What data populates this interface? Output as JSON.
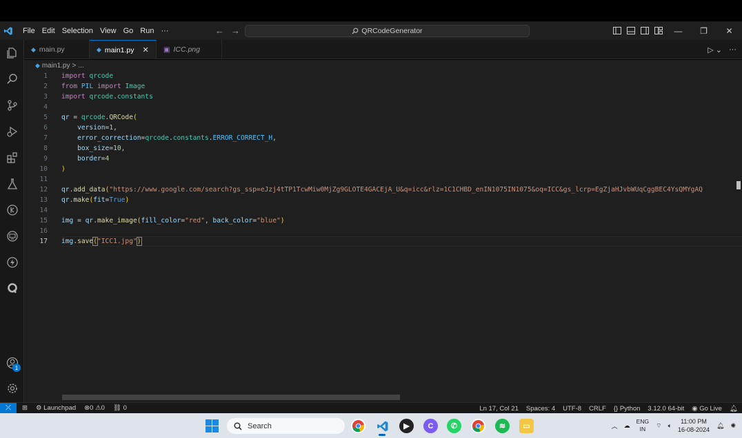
{
  "menu": [
    "File",
    "Edit",
    "Selection",
    "View",
    "Go",
    "Run",
    "···"
  ],
  "search": {
    "label": "QRCodeGenerator"
  },
  "tabs": [
    {
      "label": "main.py"
    },
    {
      "label": "main1.py"
    },
    {
      "label": "ICC.png"
    }
  ],
  "breadcrumb": {
    "file": "main1.py",
    "sep": ">",
    "rest": "..."
  },
  "editor": {
    "line_numbers": [
      "1",
      "2",
      "3",
      "4",
      "5",
      "6",
      "7",
      "8",
      "9",
      "10",
      "11",
      "12",
      "13",
      "14",
      "15",
      "16",
      "17"
    ],
    "current_line": 17,
    "lines": [
      "import qrcode",
      "from PIL import Image",
      "import qrcode.constants",
      "",
      "qr = qrcode.QRCode(",
      "    version=1,",
      "    error_correction=qrcode.constants.ERROR_CORRECT_H,",
      "    box_size=10,",
      "    border=4",
      ")",
      "",
      "qr.add_data(\"https://www.google.com/search?gs_ssp=eJzj4tTP1TcwMiw0MjZg9GLOTE4GACEjA_U&q=icc&rlz=1C1CHBD_enIN1075IN1075&oq=ICC&gs_lcrp=EgZjaHJvbWUqCggBEC4YsQMYgAQ",
      "qr.make(fit=True)",
      "",
      "img = qr.make_image(fill_color=\"red\", back_color=\"blue\")",
      "",
      "img.save(\"ICC1.jpg\")"
    ]
  },
  "activity": {
    "accounts_badge": "1"
  },
  "status": {
    "launchpad": "Launchpad",
    "errors": "0",
    "warnings": "0",
    "ports": "0",
    "position": "Ln 17, Col 21",
    "spaces": "Spaces: 4",
    "encoding": "UTF-8",
    "eol": "CRLF",
    "language": "Python",
    "interpreter": "3.12.0 64-bit",
    "golive": "Go Live"
  },
  "taskbar": {
    "search_placeholder": "Search",
    "lang_top": "ENG",
    "lang_bottom": "IN",
    "time": "11:00 PM",
    "date": "16-08-2024"
  },
  "colors": {
    "accent": "#0078d4",
    "editor_bg": "#1f1f1f",
    "keyword": "#c586c0",
    "string": "#ce9178"
  }
}
